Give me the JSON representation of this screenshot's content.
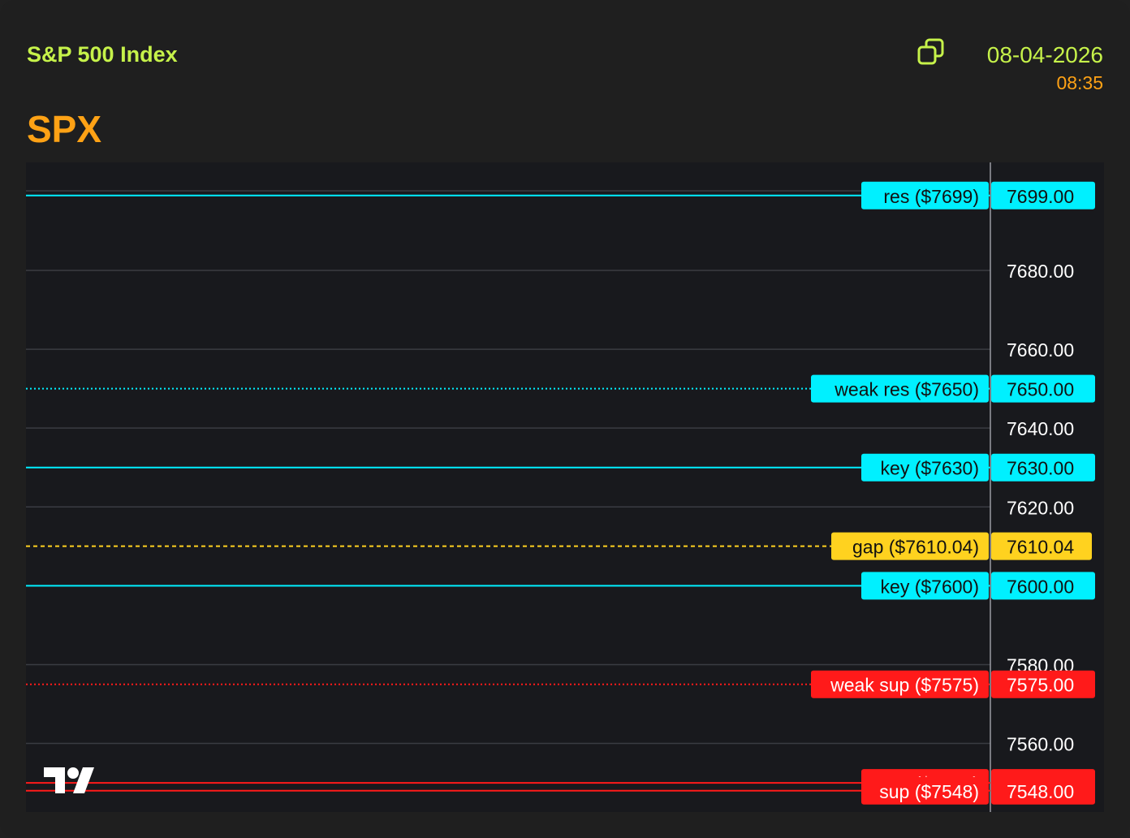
{
  "header": {
    "index_name": "S&P 500 Index",
    "ticker": "SPX",
    "date": "08-04-2026",
    "time": "08:35",
    "copy_icon": "copy-icon"
  },
  "colors": {
    "accent_green": "#c6f24a",
    "accent_orange": "#ffa215",
    "resistance": "#00f0ff",
    "gap": "#ffd21f",
    "support": "#ff1a1a",
    "grid": "#3a3c42",
    "chart_bg": "#18191d"
  },
  "chart_data": {
    "type": "line",
    "title": "",
    "xlabel": "",
    "ylabel": "",
    "ylim": [
      7542.6,
      7707.4
    ],
    "y_ticks": [
      7560,
      7580,
      7620,
      7640,
      7660,
      7680
    ],
    "y_tick_labels": [
      "7560.00",
      "7580.00",
      "7620.00",
      "7640.00",
      "7660.00",
      "7680.00"
    ],
    "grid": true,
    "levels": [
      {
        "value": 7699,
        "label": "res ($7699)",
        "price": "7699.00",
        "kind": "res",
        "style": "solid"
      },
      {
        "value": 7650,
        "label": "weak res ($7650)",
        "price": "7650.00",
        "kind": "res",
        "style": "dotted"
      },
      {
        "value": 7630,
        "label": "key ($7630)",
        "price": "7630.00",
        "kind": "res",
        "style": "solid"
      },
      {
        "value": 7610.04,
        "label": "gap ($7610.04)",
        "price": "7610.04",
        "kind": "gap",
        "style": "dashed"
      },
      {
        "value": 7600,
        "label": "key ($7600)",
        "price": "7600.00",
        "kind": "res",
        "style": "solid"
      },
      {
        "value": 7575,
        "label": "weak sup ($7575)",
        "price": "7575.00",
        "kind": "sup",
        "style": "dotted"
      },
      {
        "value": 7550,
        "label": "sup ($7550)",
        "price": "7550.00",
        "kind": "sup",
        "style": "solid"
      },
      {
        "value": 7548,
        "label": "sup ($7548)",
        "price": "7548.00",
        "kind": "sup",
        "style": "solid"
      }
    ],
    "logo": "tradingview-logo"
  }
}
